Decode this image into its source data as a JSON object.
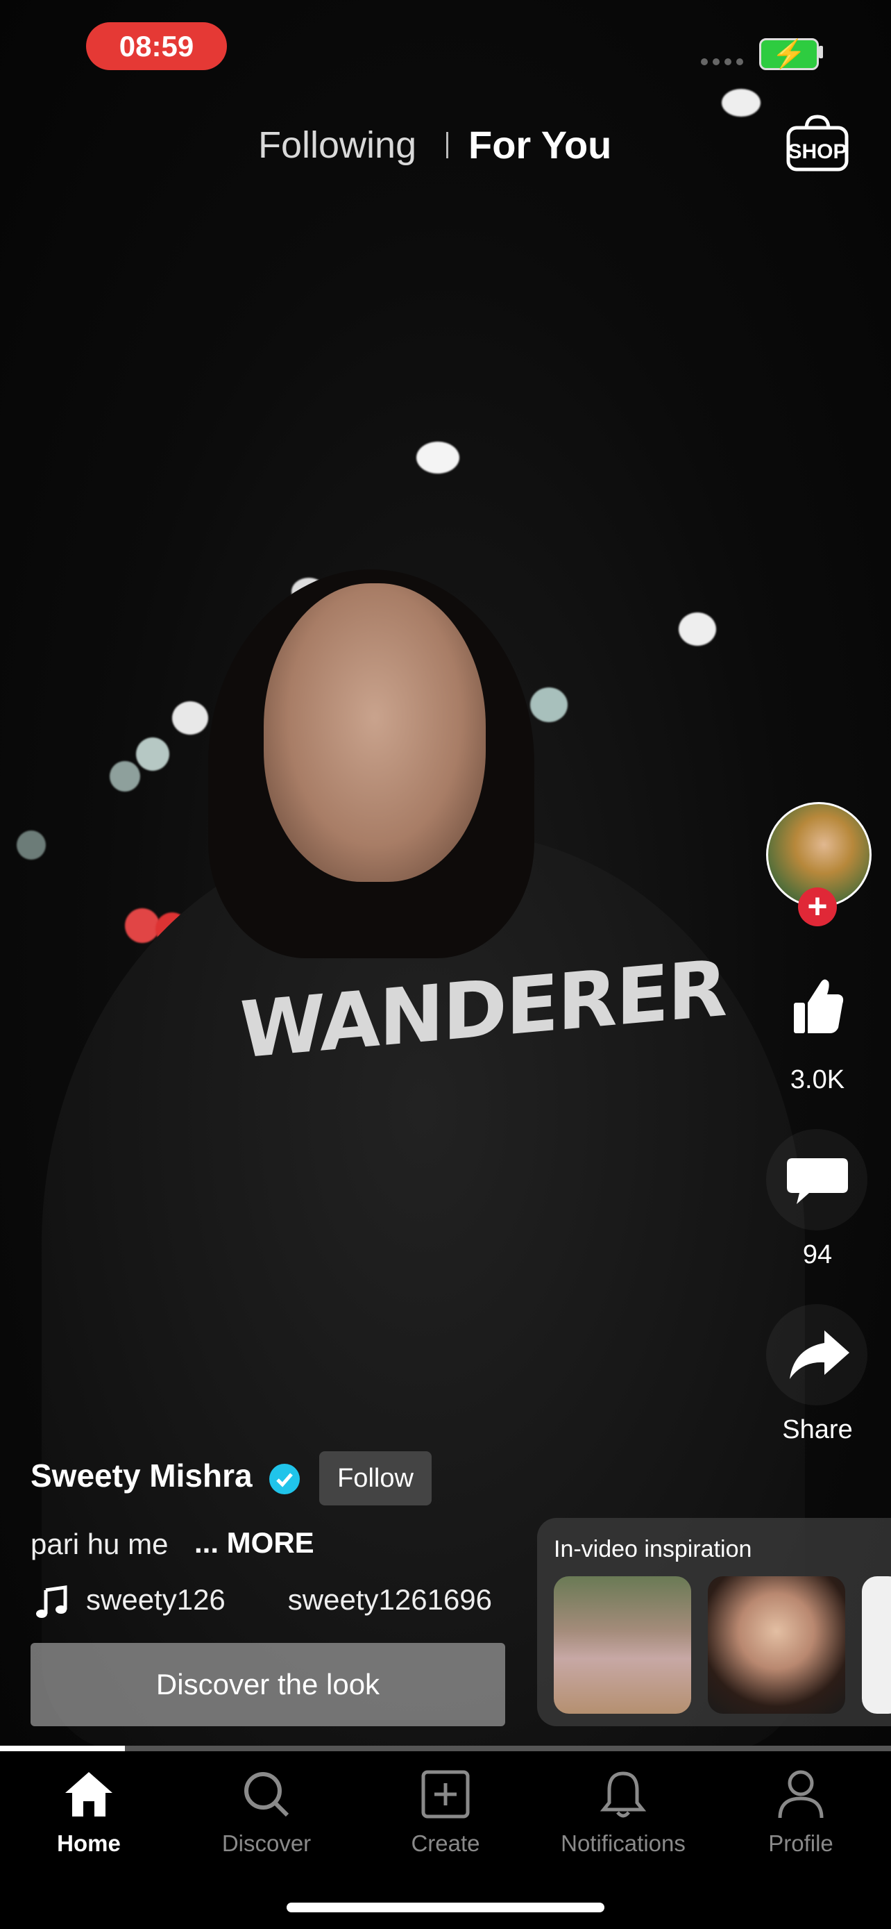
{
  "status_bar": {
    "time": "08:59",
    "accent": "#e53935",
    "battery_color": "#2ecc40"
  },
  "top_tabs": {
    "following": "Following",
    "for_you": "For You",
    "shop_label": "SHOP"
  },
  "video": {
    "hoodie_text": "WANDERER"
  },
  "actions": {
    "likes": "3.0K",
    "comments": "94",
    "share": "Share"
  },
  "post": {
    "username": "Sweety Mishra",
    "follow_label": "Follow",
    "caption": "pari hu me",
    "more_label": "... MORE",
    "music_part1": "sweety126",
    "music_part2": "sweety1261696"
  },
  "discover_look": "Discover the look",
  "inspiration": {
    "title": "In-video inspiration"
  },
  "progress": {
    "fraction": 0.14
  },
  "nav": {
    "items": [
      {
        "label": "Home"
      },
      {
        "label": "Discover"
      },
      {
        "label": "Create"
      },
      {
        "label": "Notifications"
      },
      {
        "label": "Profile"
      }
    ]
  }
}
